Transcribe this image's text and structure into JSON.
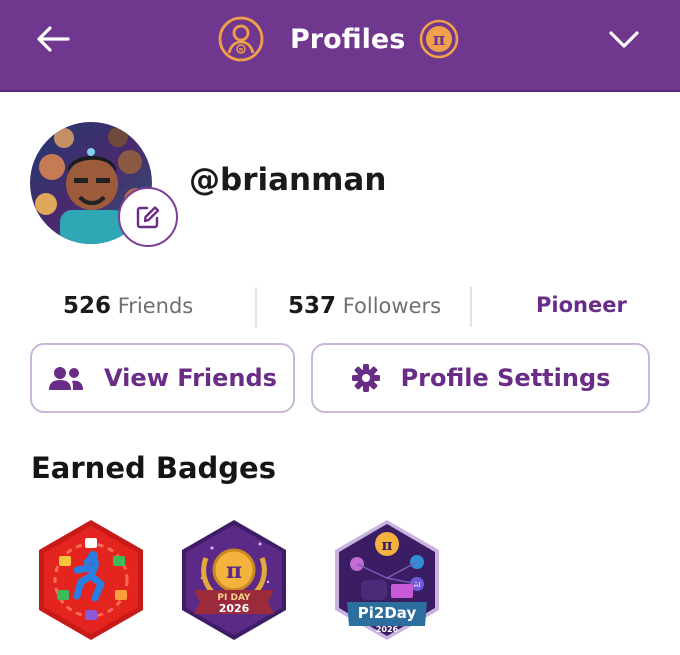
{
  "header": {
    "title": "Profiles",
    "colors": {
      "bar": "#70378e",
      "accent": "#f0a04b"
    },
    "icons": [
      "back-arrow-icon",
      "profile-circle-icon",
      "pi-coin-icon",
      "chevron-down-icon"
    ]
  },
  "profile": {
    "username": "@brianman",
    "avatar_icon": "avatar-image",
    "edit_icon": "edit-pencil-icon"
  },
  "stats": {
    "friends_count": "526",
    "friends_label": "Friends",
    "followers_count": "537",
    "followers_label": "Followers",
    "role": "Pioneer"
  },
  "actions": {
    "view_friends": "View Friends",
    "profile_settings": "Profile Settings"
  },
  "badges": {
    "title": "Earned Badges",
    "items": [
      {
        "icon": "app-activity-badge",
        "color": "#e3241f"
      },
      {
        "icon": "pi-day-2026-badge",
        "label": "PI DAY",
        "year": "2026",
        "color": "#5a2a86"
      },
      {
        "icon": "pi2day-2026-badge",
        "label": "Pi2Day",
        "year": "2026",
        "color": "#3b1d63"
      }
    ]
  }
}
